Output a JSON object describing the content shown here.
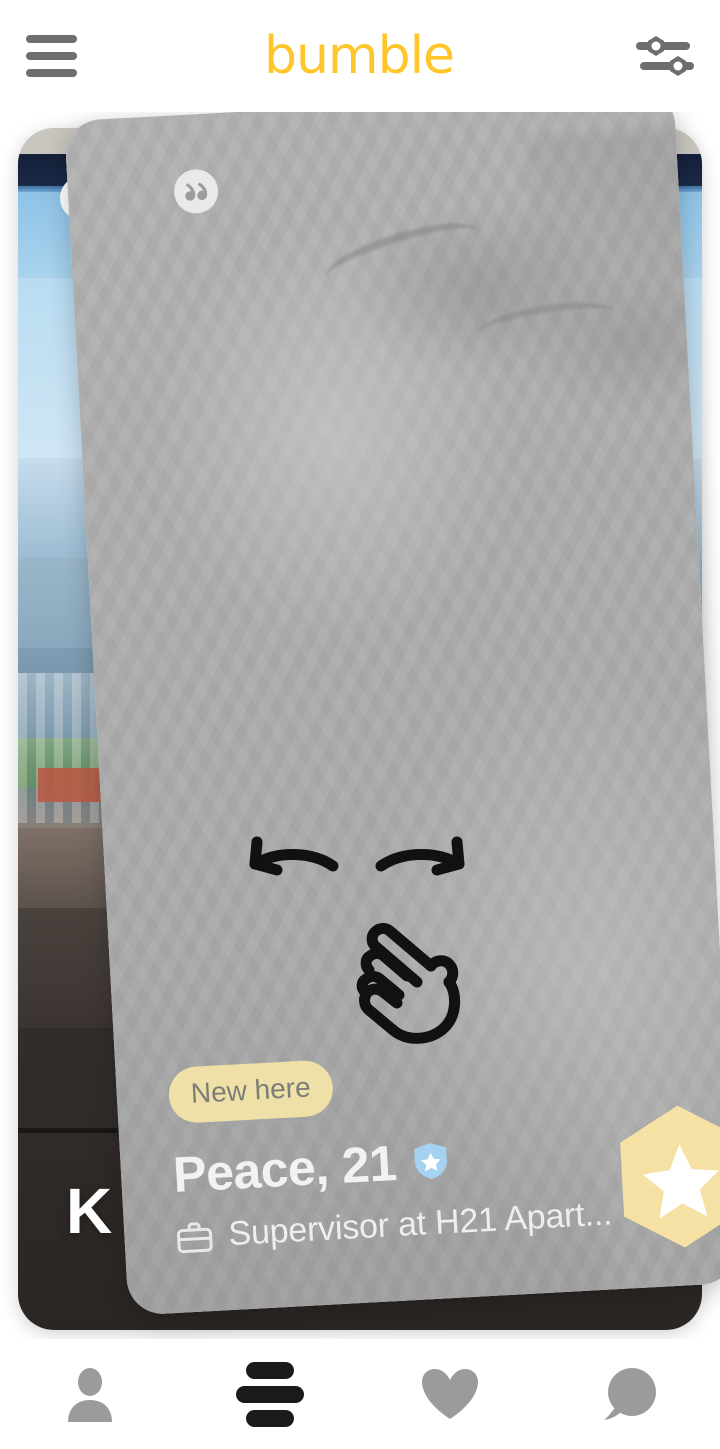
{
  "header": {
    "menu_icon": "hamburger-menu-icon",
    "brand": "bumble",
    "filter_icon": "filter-sliders-icon"
  },
  "cards": {
    "back": {
      "name": "K",
      "quote_icon": "quotation-marks-icon"
    },
    "front": {
      "quote_icon": "quotation-marks-icon",
      "new_here_label": "New here",
      "name_age": "Peace, 21",
      "verified_icon": "verified-shield-star-icon",
      "job_icon": "briefcase-icon",
      "job": "Supervisor at H21 Apart...",
      "superswipe_icon": "superswipe-star-hexagon-icon"
    }
  },
  "tutorial": {
    "left_arrow_icon": "swipe-left-arrow-icon",
    "right_arrow_icon": "swipe-right-arrow-icon",
    "hand_icon": "pointing-hand-swipe-icon"
  },
  "bottom_nav": {
    "items": [
      {
        "name": "profile",
        "icon": "person-icon",
        "active": false
      },
      {
        "name": "discover",
        "icon": "hive-bars-icon",
        "active": true
      },
      {
        "name": "likes",
        "icon": "heart-icon",
        "active": false
      },
      {
        "name": "chats",
        "icon": "speech-bubble-icon",
        "active": false
      }
    ]
  },
  "colors": {
    "brand_yellow": "#FFC62B",
    "new_here_pill": "#EFE0A8",
    "superswipe_hex": "#FCE6A4",
    "verified_blue": "#A5D2F0",
    "nav_inactive": "#9B9B9B",
    "nav_active": "#1A1A1A"
  }
}
